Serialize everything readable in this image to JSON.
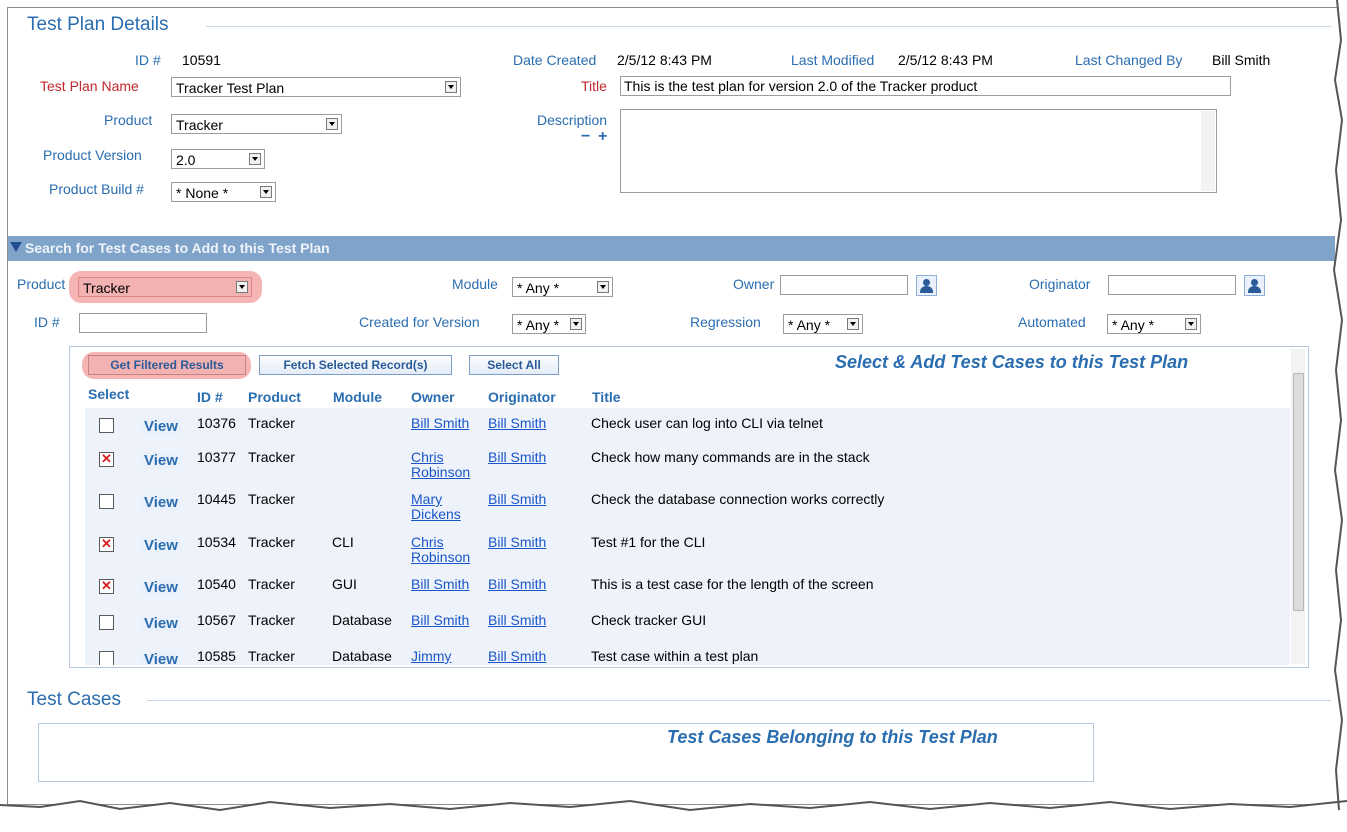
{
  "details": {
    "section_title": "Test Plan Details",
    "id_label": "ID #",
    "id_value": "10591",
    "date_created_label": "Date Created",
    "date_created_value": "2/5/12 8:43 PM",
    "last_modified_label": "Last Modified",
    "last_modified_value": "2/5/12 8:43 PM",
    "last_changed_by_label": "Last Changed By",
    "last_changed_by_value": "Bill Smith",
    "test_plan_name_label": "Test Plan Name",
    "test_plan_name_value": "Tracker Test Plan",
    "title_label": "Title",
    "title_value": "This is the test plan for version 2.0 of the Tracker product",
    "product_label": "Product",
    "product_value": "Tracker",
    "description_label": "Description",
    "desc_minus": "−",
    "desc_plus": "+",
    "product_version_label": "Product Version",
    "product_version_value": "2.0",
    "product_build_label": "Product Build #",
    "product_build_value": "* None *"
  },
  "search": {
    "header": "Search for Test Cases to Add to this Test Plan",
    "product_label": "Product",
    "product_value": "Tracker",
    "module_label": "Module",
    "module_value": "* Any *",
    "owner_label": "Owner",
    "owner_value": "",
    "originator_label": "Originator",
    "originator_value": "",
    "id_label": "ID #",
    "id_value": "",
    "created_for_version_label": "Created for Version",
    "created_for_version_value": "* Any *",
    "regression_label": "Regression",
    "regression_value": "* Any *",
    "automated_label": "Automated",
    "automated_value": "* Any *"
  },
  "results": {
    "get_filtered_label": "Get Filtered Results",
    "fetch_selected_label": "Fetch Selected Record(s)",
    "select_all_label": "Select All",
    "heading": "Select & Add Test Cases to this Test Plan",
    "columns": {
      "select": "Select",
      "id": "ID #",
      "product": "Product",
      "module": "Module",
      "owner": "Owner",
      "originator": "Originator",
      "title": "Title"
    },
    "view_label": "View",
    "rows": [
      {
        "checked": false,
        "id": "10376",
        "product": "Tracker",
        "module": "",
        "owner1": "Bill Smith",
        "owner2": "",
        "originator": "Bill Smith",
        "title": "Check user can log into CLI via telnet"
      },
      {
        "checked": true,
        "id": "10377",
        "product": "Tracker",
        "module": "",
        "owner1": "Chris",
        "owner2": "Robinson",
        "originator": "Bill Smith",
        "title": "Check how many commands are in the stack"
      },
      {
        "checked": false,
        "id": "10445",
        "product": "Tracker",
        "module": "",
        "owner1": "Mary",
        "owner2": "Dickens",
        "originator": "Bill Smith",
        "title": "Check the database connection works correctly"
      },
      {
        "checked": true,
        "id": "10534",
        "product": "Tracker",
        "module": "CLI",
        "owner1": "Chris",
        "owner2": "Robinson",
        "originator": "Bill Smith",
        "title": "Test #1 for the CLI"
      },
      {
        "checked": true,
        "id": "10540",
        "product": "Tracker",
        "module": "GUI",
        "owner1": "Bill Smith",
        "owner2": "",
        "originator": "Bill Smith",
        "title": "This is a test case for the length of the screen"
      },
      {
        "checked": false,
        "id": "10567",
        "product": "Tracker",
        "module": "Database",
        "owner1": "Bill Smith",
        "owner2": "",
        "originator": "Bill Smith",
        "title": "Check tracker GUI"
      },
      {
        "checked": false,
        "id": "10585",
        "product": "Tracker",
        "module": "Database",
        "owner1": "Jimmy",
        "owner2": "",
        "originator": "Bill Smith",
        "title": "Test case within a test plan"
      }
    ]
  },
  "test_cases": {
    "section_title": "Test Cases",
    "heading": "Test Cases Belonging to this Test Plan"
  },
  "colors": {
    "accent_blue": "#2a6db0",
    "header_bar": "#7fa3c9",
    "required_red": "#c0282e",
    "highlight": "#ec7878"
  }
}
